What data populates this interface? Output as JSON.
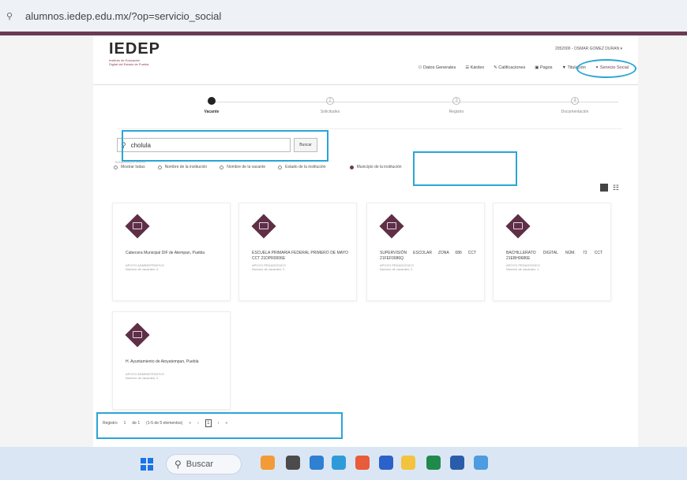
{
  "browser": {
    "url": "alumnos.iedep.edu.mx/?op=servicio_social",
    "site_icon": "site-info-icon"
  },
  "header": {
    "logo_text": "IEDEP",
    "logo_sub1": "Instituto de Educación",
    "logo_sub2": "Digital del Estado de Puebla",
    "user_label": "2052000 - OSMAR GOMEZ DURAN",
    "nav": [
      {
        "label": "Datos Generales",
        "icon": "user-icon"
      },
      {
        "label": "Kárdex",
        "icon": "list-icon"
      },
      {
        "label": "Calificaciones",
        "icon": "grades-icon"
      },
      {
        "label": "Pagos",
        "icon": "payment-icon"
      },
      {
        "label": "Titulación",
        "icon": "graduation-icon"
      },
      {
        "label": "Servicio Social",
        "icon": "service-icon"
      }
    ]
  },
  "steps": [
    {
      "label": "Vacante",
      "number": "1"
    },
    {
      "label": "Solicitudes",
      "number": "2"
    },
    {
      "label": "Registro",
      "number": "3"
    },
    {
      "label": "Documentación",
      "number": "4"
    }
  ],
  "search": {
    "value": "cholula",
    "button_label": "Buscar"
  },
  "filters": {
    "title": "Búsqueda por criterio",
    "options": [
      {
        "label": "Mostrar todas"
      },
      {
        "label": "Nombre de la institución"
      },
      {
        "label": "Nombre de la vacante"
      },
      {
        "label": "Estado de la institución"
      },
      {
        "label": "Municipio de la institución"
      }
    ]
  },
  "cards": [
    {
      "name": "Cabecera Municipal DIF de Atempan, Puebla",
      "type": "APOYO ADMINISTRATIVO",
      "vacancies": "Número de vacantes: 4"
    },
    {
      "name": "ESCUELA PRIMARIA FEDERAL PRIMERO DE MAYO CCT 21DPR0006E",
      "type": "APOYO PEDAGÓGICO",
      "vacancies": "Número de vacantes: 2"
    },
    {
      "name": "SUPERVISIÓN ESCOLAR ZONA 086 CCT 21FEF0086Q",
      "type": "APOYO PEDAGÓGICO",
      "vacancies": "Número de vacantes: 2"
    },
    {
      "name": "BACHILLERATO DIGITAL NÚM. 72 CCT 21EBH0686E",
      "type": "APOYO PEDAGÓGICO",
      "vacancies": "Número de vacantes: 1"
    },
    {
      "name": "H. Ayuntamiento de Atoyatempan, Puebla",
      "type": "APOYO ADMINISTRATIVO",
      "vacancies": "Número de vacantes: 2"
    }
  ],
  "pager": {
    "records_label": "Registro",
    "of_label": "de 1",
    "range_label": "(1-5 de 5 elementos)",
    "current_page": "1",
    "first": "«",
    "prev": "‹",
    "next": "›",
    "last": "»"
  },
  "taskbar": {
    "search_label": "Buscar"
  },
  "highlight_color": "#2aa5d6",
  "brand_color": "#6a3b52"
}
